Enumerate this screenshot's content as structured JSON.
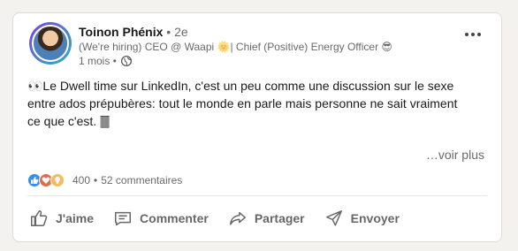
{
  "post": {
    "author_name": "Toinon Phénix",
    "degree": " • 2e",
    "headline": "(We're hiring) CEO @ Waapi 🌞| Chief (Positive) Energy Officer 😎",
    "time": "1 mois •",
    "body_line_1": "👀Le Dwell time sur LinkedIn, c'est un peu comme une discussion sur le sexe",
    "body_line_2": "entre ados prépubères: tout le monde en parle mais personne ne sait vraiment",
    "body_line_3": "ce que c'est. 🀫",
    "see_more": "…voir plus",
    "reaction_count": "400",
    "separator": "•",
    "comments": "52 commentaires"
  },
  "actions": {
    "like": "J'aime",
    "comment": "Commenter",
    "share": "Partager",
    "send": "Envoyer"
  },
  "icons": {
    "more": "more-icon",
    "globe": "globe-icon",
    "like": "thumbs-up-icon",
    "love": "heart-icon",
    "insight": "lightbulb-icon",
    "comment": "comment-icon",
    "share": "share-icon",
    "send": "send-icon"
  },
  "colors": {
    "like": "#378fe9",
    "love": "#df704d",
    "insight": "#f5bb5c"
  }
}
